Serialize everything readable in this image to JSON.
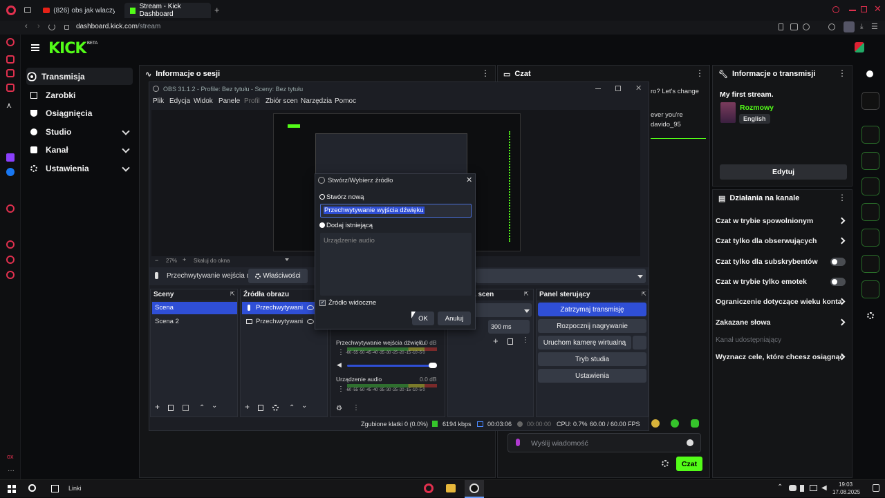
{
  "browser": {
    "tabs": [
      {
        "label": "(826) obs jak wlaczyc m..."
      },
      {
        "label": "Stream - Kick Dashboard"
      }
    ],
    "url_domain": "dashboard.kick.com",
    "url_path": "/stream"
  },
  "kick": {
    "logo": "KICK",
    "beta": "BETA",
    "nav": [
      {
        "label": "Transmisja"
      },
      {
        "label": "Zarobki"
      },
      {
        "label": "Osiągnięcia"
      },
      {
        "label": "Studio"
      },
      {
        "label": "Kanał"
      },
      {
        "label": "Ustawienia"
      }
    ],
    "session_panel": "Informacje o sesji",
    "chat_panel": "Czat",
    "chat_lines": [
      "ro? Let's change",
      "ever you're",
      "davido_95"
    ],
    "stream_info": {
      "title": "Informacje o transmisji",
      "stream_title": "My first stream.",
      "category": "Rozmowy",
      "language": "English",
      "edit_button": "Edytuj"
    },
    "channel_actions": {
      "title": "Działania na kanale",
      "items": [
        {
          "label": "Czat w trybie spowolnionym"
        },
        {
          "label": "Czat tylko dla obserwujących"
        },
        {
          "label": "Czat tylko dla subskrybentów"
        },
        {
          "label": "Czat w trybie tylko emotek"
        },
        {
          "label": "Ograniczenie dotyczące wieku konta"
        },
        {
          "label": "Zakazane słowa"
        },
        {
          "label": "Kanał udostępniający"
        },
        {
          "label": "Wyznacz cele, które chcesz osiągnąć"
        }
      ]
    },
    "chat_input_placeholder": "Wyślij wiadomość",
    "chat_send": "Czat"
  },
  "obs": {
    "title": "OBS 31.1.2 - Profile: Bez tytułu - Sceny: Bez tytułu",
    "menu": [
      "Plik",
      "Edycja",
      "Widok",
      "Panele",
      "Profil",
      "Zbiór scen",
      "Narzędzia",
      "Pomoc"
    ],
    "zoom": "27%",
    "scale_label": "Skaluj do okna",
    "source_selected": "Przechwytywanie wejścia d",
    "properties_button": "Właściwości",
    "scenes_title": "Sceny",
    "scenes": [
      "Scena",
      "Scena 2"
    ],
    "sources_title": "Źródła obrazu",
    "sources": [
      "Przechwytywani",
      "Przechwytywani"
    ],
    "transitions_title": "rzejścia scen",
    "transition_duration_label": "nia",
    "transition_duration": "300 ms",
    "mixer": [
      {
        "name": "Przechwytywanie wejścia dźwięku",
        "db": "0.0 dB"
      },
      {
        "name": "Urządzenie audio",
        "db": "0.0 dB"
      }
    ],
    "meter_scale": "-60 -55 -50 -45 -40 -35 -30 -25 -20 -15 -10 -5 0",
    "controls_title": "Panel sterujący",
    "controls": [
      "Zatrzymaj transmisję",
      "Rozpocznij nagrywanie",
      "Uruchom kamerę wirtualną",
      "Tryb studia",
      "Ustawienia"
    ],
    "status": {
      "dropped": "Zgubione klatki 0 (0.0%)",
      "bitrate": "6194 kbps",
      "live_time": "00:03:06",
      "rec_time": "00:00:00",
      "cpu": "CPU: 0.7%",
      "fps": "60.00 / 60.00 FPS"
    }
  },
  "dialog": {
    "title": "Stwórz/Wybierz źródło",
    "create_new": "Stwórz nową",
    "name_value": "Przechwytywanie wyjścia dźwięku",
    "add_existing": "Dodaj istniejącą",
    "existing_item": "Urządzenie audio",
    "visible_checkbox": "Źródło widoczne",
    "ok": "OK",
    "cancel": "Anuluj"
  },
  "taskbar": {
    "links": "Linki",
    "time": "19:03",
    "date": "17.08.2025"
  },
  "colors": {
    "kick_green": "#53fc18",
    "obs_accent": "#2f4fd6",
    "opera_red": "#e0304e"
  }
}
